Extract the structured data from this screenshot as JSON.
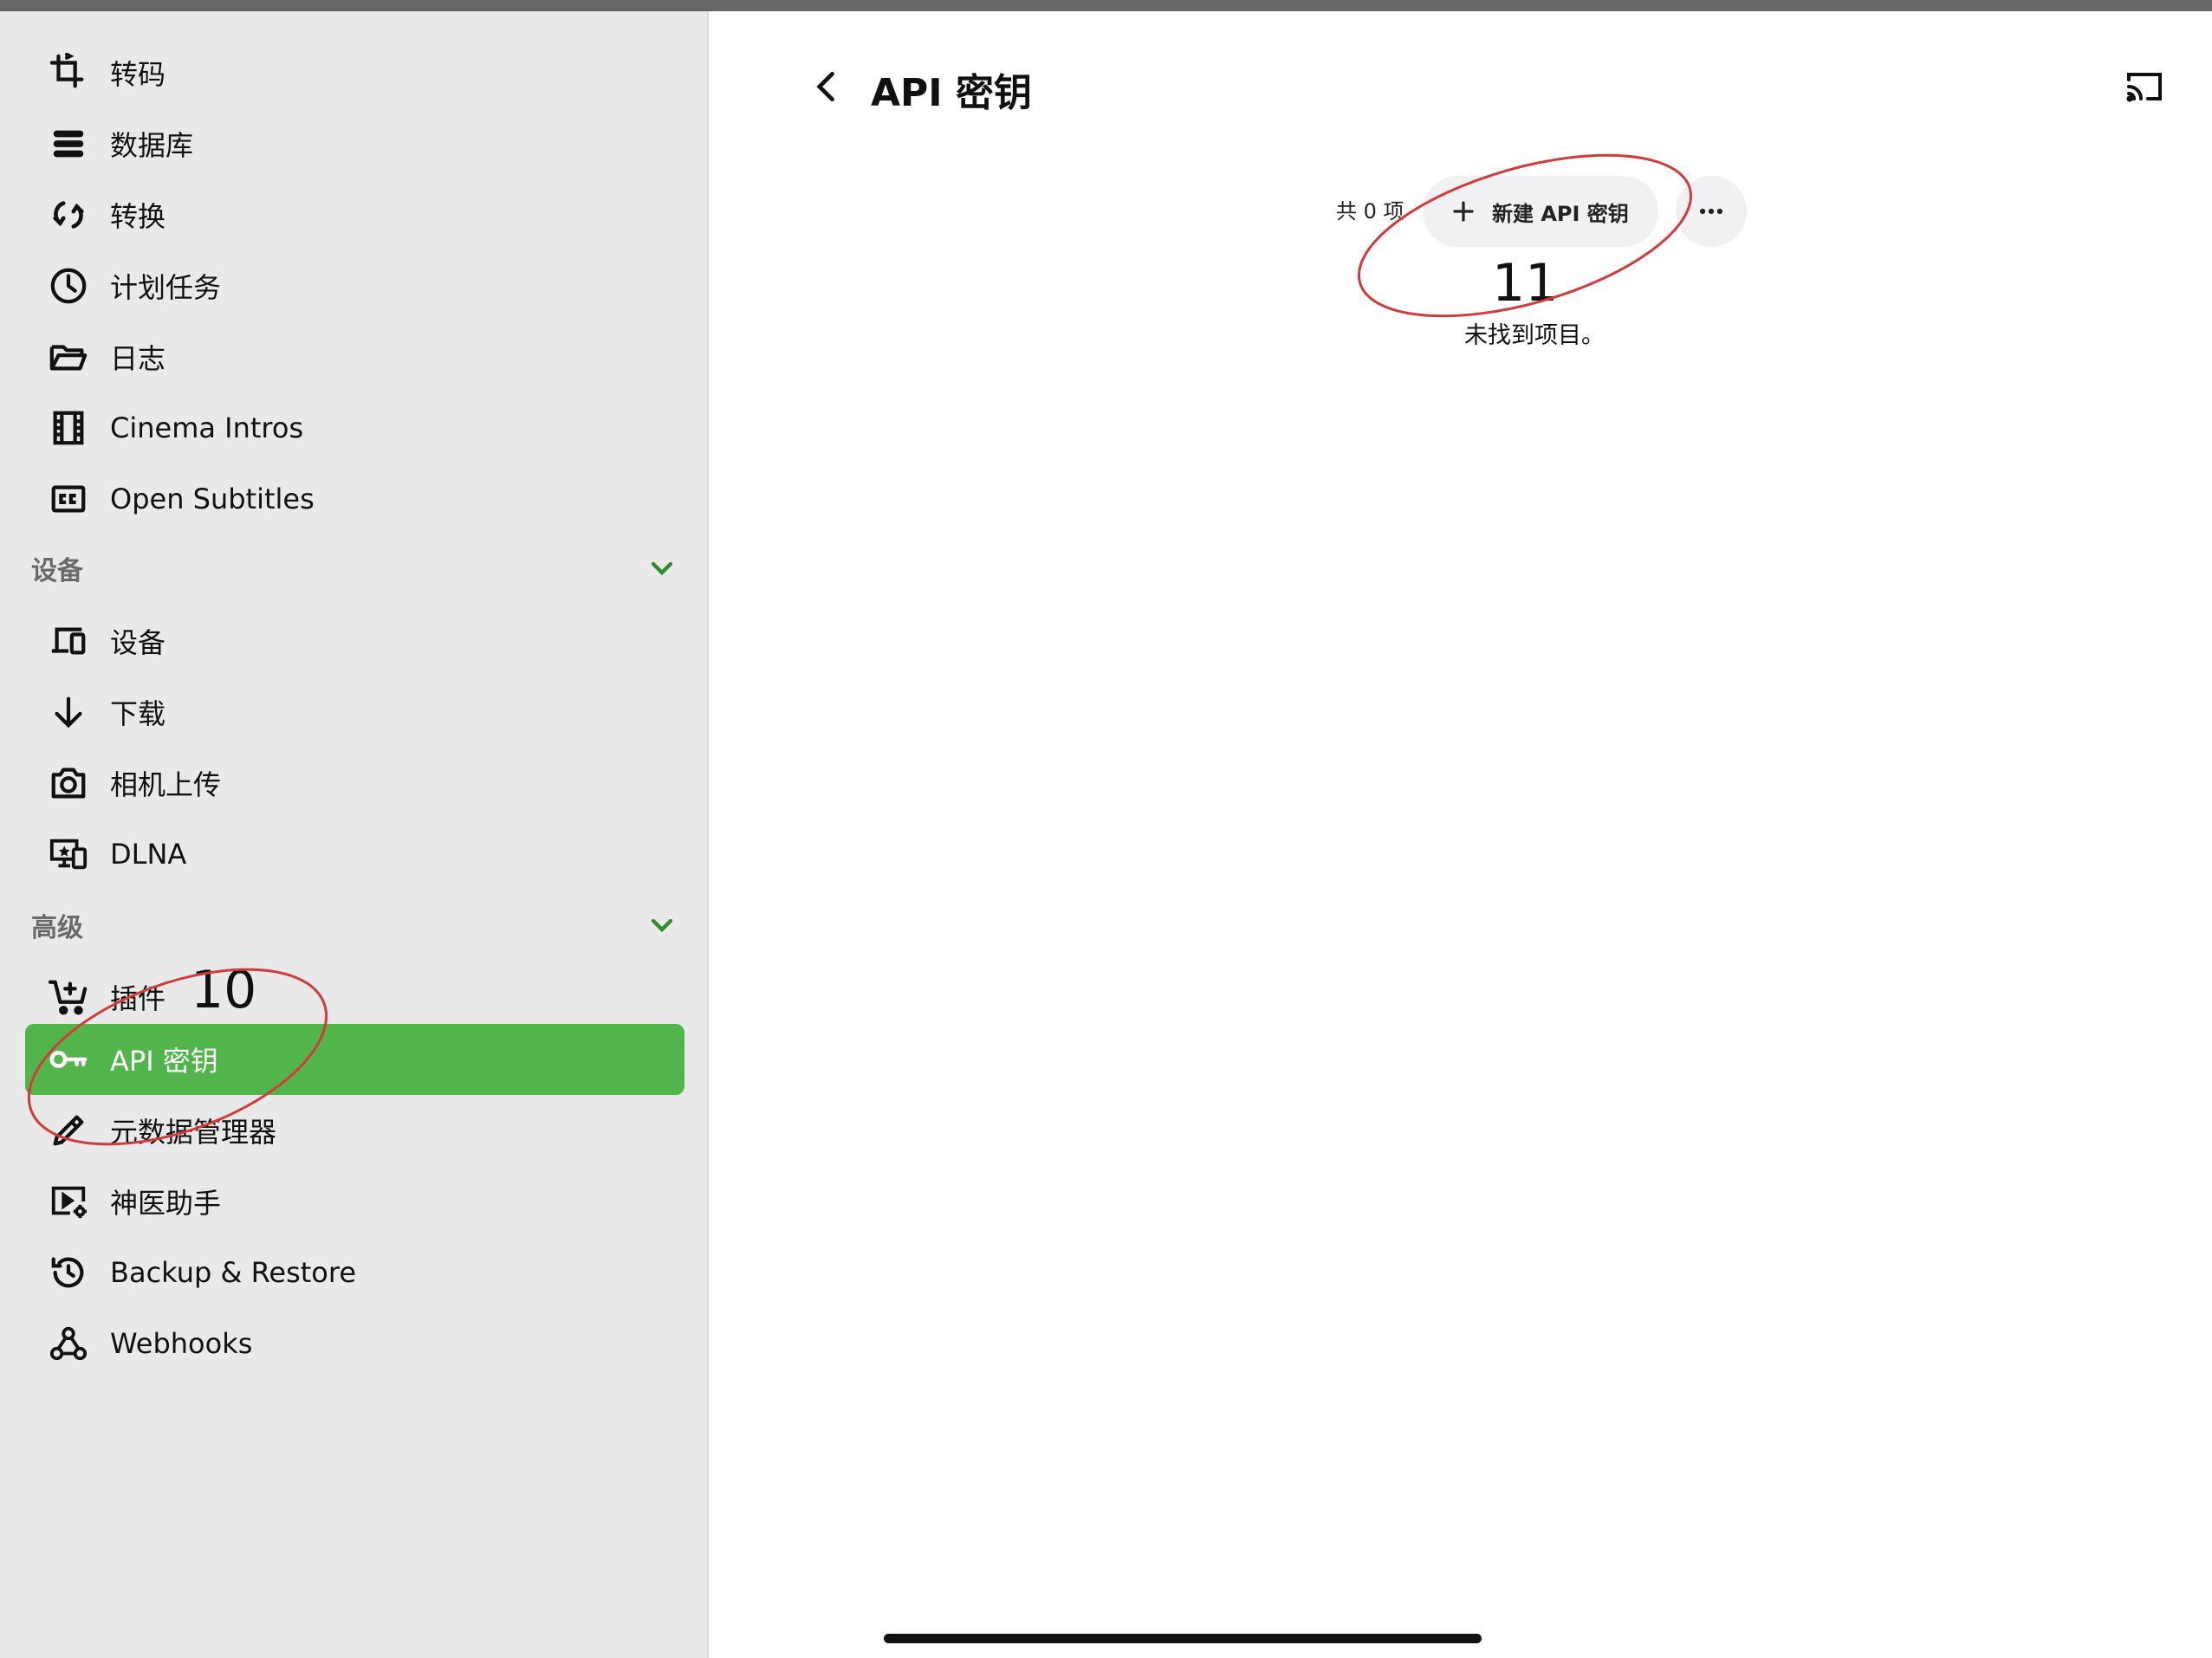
{
  "sidebar": {
    "items_top": [
      {
        "label": "转码",
        "icon": "crop-transcode-icon"
      },
      {
        "label": "数据库",
        "icon": "database-icon"
      },
      {
        "label": "转换",
        "icon": "convert-arrows-icon"
      },
      {
        "label": "计划任务",
        "icon": "clock-icon"
      },
      {
        "label": "日志",
        "icon": "folder-open-icon"
      },
      {
        "label": "Cinema Intros",
        "icon": "film-strip-icon"
      },
      {
        "label": "Open Subtitles",
        "icon": "closed-caption-icon"
      }
    ],
    "section_devices": {
      "title": "设备",
      "items": [
        {
          "label": "设备",
          "icon": "devices-icon"
        },
        {
          "label": "下载",
          "icon": "arrow-down-icon"
        },
        {
          "label": "相机上传",
          "icon": "camera-icon"
        },
        {
          "label": "DLNA",
          "icon": "dlna-icon"
        }
      ]
    },
    "section_advanced": {
      "title": "高级",
      "items": [
        {
          "label": "插件",
          "icon": "cart-plus-icon"
        },
        {
          "label": "API 密钥",
          "icon": "key-icon",
          "active": true
        },
        {
          "label": "元数据管理器",
          "icon": "pencil-icon"
        },
        {
          "label": "神医助手",
          "icon": "video-settings-icon"
        },
        {
          "label": "Backup & Restore",
          "icon": "restore-icon"
        },
        {
          "label": "Webhooks",
          "icon": "webhook-icon"
        }
      ]
    },
    "active_color": "#52b54b"
  },
  "header": {
    "title": "API 密钥",
    "back_icon": "chevron-left-icon",
    "cast_icon": "cast-icon"
  },
  "toolbar": {
    "count_text": "共 0 项",
    "new_button_label": "新建 API 密钥",
    "more_icon": "more-horizontal-icon"
  },
  "empty_message": "未找到项目。",
  "annotations": {
    "label_10": "10",
    "label_11": "11"
  }
}
